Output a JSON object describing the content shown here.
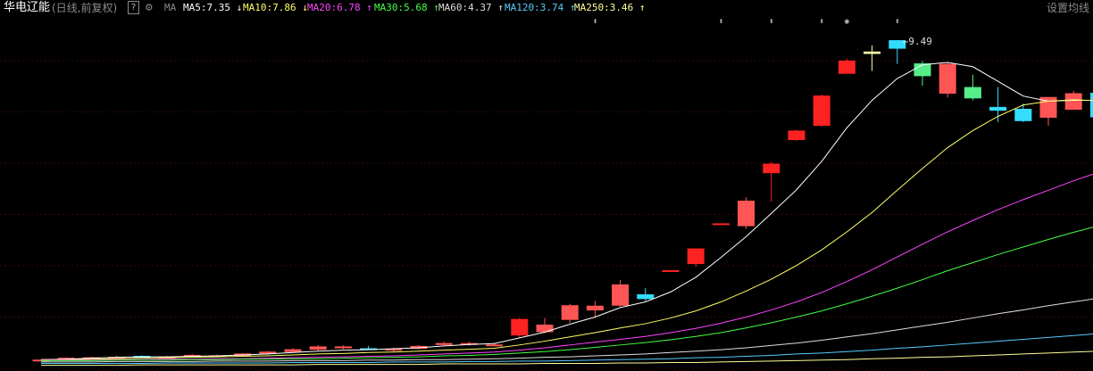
{
  "toolbar": {
    "stock_name": "华电辽能",
    "period": "(日线,前复权)",
    "help": "?",
    "indicator": "MA",
    "settings": "设置均线"
  },
  "ma_legend": [
    {
      "label": "MA5:7.35",
      "arrow": "↓",
      "color": "#ffffff"
    },
    {
      "label": "MA10:7.86",
      "arrow": "↓",
      "color": "#ffff66"
    },
    {
      "label": "MA20:6.78",
      "arrow": "↑",
      "color": "#ff44ff"
    },
    {
      "label": "MA30:5.68",
      "arrow": "↑",
      "color": "#44ff44"
    },
    {
      "label": "MA60:4.37",
      "arrow": "↑",
      "color": "#dddddd"
    },
    {
      "label": "MA120:3.74",
      "arrow": "↑",
      "color": "#55ccff"
    },
    {
      "label": "MA250:3.46",
      "arrow": "↑",
      "color": "#ffff99"
    }
  ],
  "colors": {
    "up_hollow": "#ff5555",
    "up_solid": "#ee0000",
    "down": "#33ddff",
    "limit_up": "#ff2222",
    "green_candle": "#55ee88",
    "doji": "#ffffaa",
    "grid": "#3a0a0a"
  },
  "high_marker": "←9.49",
  "markers": [
    "⬍",
    "⬍",
    "⬍",
    "⬍",
    "✱",
    "⬍"
  ],
  "chart_data": {
    "type": "candlestick",
    "y_range": [
      2.5,
      10.0
    ],
    "candles": [
      {
        "o": 2.73,
        "h": 2.75,
        "l": 2.71,
        "c": 2.74,
        "k": "up"
      },
      {
        "o": 2.74,
        "h": 2.79,
        "l": 2.73,
        "c": 2.78,
        "k": "up"
      },
      {
        "o": 2.78,
        "h": 2.8,
        "l": 2.76,
        "c": 2.79,
        "k": "up"
      },
      {
        "o": 2.79,
        "h": 2.82,
        "l": 2.77,
        "c": 2.8,
        "k": "up"
      },
      {
        "o": 2.8,
        "h": 2.83,
        "l": 2.79,
        "c": 2.82,
        "k": "dn"
      },
      {
        "o": 2.8,
        "h": 2.82,
        "l": 2.78,
        "c": 2.79,
        "k": "up"
      },
      {
        "o": 2.81,
        "h": 2.86,
        "l": 2.79,
        "c": 2.84,
        "k": "up"
      },
      {
        "o": 2.82,
        "h": 2.85,
        "l": 2.8,
        "c": 2.83,
        "k": "up"
      },
      {
        "o": 2.82,
        "h": 2.88,
        "l": 2.81,
        "c": 2.87,
        "k": "up"
      },
      {
        "o": 2.86,
        "h": 2.92,
        "l": 2.84,
        "c": 2.91,
        "k": "up"
      },
      {
        "o": 2.9,
        "h": 2.98,
        "l": 2.88,
        "c": 2.96,
        "k": "up"
      },
      {
        "o": 2.95,
        "h": 3.05,
        "l": 2.93,
        "c": 3.02,
        "k": "up"
      },
      {
        "o": 3.02,
        "h": 3.04,
        "l": 2.96,
        "c": 2.98,
        "k": "up"
      },
      {
        "o": 2.98,
        "h": 3.03,
        "l": 2.95,
        "c": 2.96,
        "k": "dn"
      },
      {
        "o": 2.93,
        "h": 2.99,
        "l": 2.91,
        "c": 2.97,
        "k": "up"
      },
      {
        "o": 2.97,
        "h": 3.05,
        "l": 2.95,
        "c": 3.03,
        "k": "up"
      },
      {
        "o": 3.05,
        "h": 3.12,
        "l": 3.02,
        "c": 3.09,
        "k": "up"
      },
      {
        "o": 3.09,
        "h": 3.12,
        "l": 3.03,
        "c": 3.06,
        "k": "up"
      },
      {
        "o": 3.06,
        "h": 3.1,
        "l": 3.03,
        "c": 3.05,
        "k": "up"
      },
      {
        "o": 3.25,
        "h": 3.62,
        "l": 3.2,
        "c": 3.6,
        "k": "lim"
      },
      {
        "o": 3.32,
        "h": 3.62,
        "l": 3.3,
        "c": 3.48,
        "k": "up"
      },
      {
        "o": 3.58,
        "h": 3.92,
        "l": 3.52,
        "c": 3.89,
        "k": "up"
      },
      {
        "o": 3.78,
        "h": 3.98,
        "l": 3.62,
        "c": 3.88,
        "k": "up"
      },
      {
        "o": 3.88,
        "h": 4.42,
        "l": 3.86,
        "c": 4.33,
        "k": "up"
      },
      {
        "o": 4.02,
        "h": 4.25,
        "l": 3.98,
        "c": 4.12,
        "k": "dn"
      },
      {
        "o": 4.62,
        "h": 4.62,
        "l": 4.62,
        "c": 4.63,
        "k": "flat"
      },
      {
        "o": 4.76,
        "h": 5.09,
        "l": 4.7,
        "c": 5.09,
        "k": "lim"
      },
      {
        "o": 5.62,
        "h": 5.62,
        "l": 5.6,
        "c": 5.6,
        "k": "flat"
      },
      {
        "o": 5.56,
        "h": 6.17,
        "l": 5.5,
        "c": 6.1,
        "k": "up"
      },
      {
        "o": 6.68,
        "h": 6.92,
        "l": 6.08,
        "c": 6.88,
        "k": "lim"
      },
      {
        "o": 7.38,
        "h": 7.6,
        "l": 7.36,
        "c": 7.58,
        "k": "lim"
      },
      {
        "o": 7.68,
        "h": 8.34,
        "l": 7.66,
        "c": 8.32,
        "k": "lim"
      },
      {
        "o": 8.78,
        "h": 9.1,
        "l": 8.78,
        "c": 9.06,
        "k": "lim"
      },
      {
        "o": 9.25,
        "h": 9.38,
        "l": 8.84,
        "c": 9.2,
        "k": "doji"
      },
      {
        "o": 9.49,
        "h": 9.49,
        "l": 8.99,
        "c": 9.31,
        "k": "dn"
      },
      {
        "o": 8.73,
        "h": 9.05,
        "l": 8.53,
        "c": 9.0,
        "k": "grn"
      },
      {
        "o": 8.36,
        "h": 9.01,
        "l": 8.28,
        "c": 8.99,
        "k": "up"
      },
      {
        "o": 8.26,
        "h": 8.76,
        "l": 8.22,
        "c": 8.5,
        "k": "grn"
      },
      {
        "o": 8.0,
        "h": 8.5,
        "l": 7.76,
        "c": 8.08,
        "k": "dn"
      },
      {
        "o": 7.78,
        "h": 8.15,
        "l": 7.76,
        "c": 8.04,
        "k": "dn"
      },
      {
        "o": 7.85,
        "h": 8.29,
        "l": 7.68,
        "c": 8.29,
        "k": "up"
      },
      {
        "o": 8.02,
        "h": 8.42,
        "l": 8.02,
        "c": 8.37,
        "k": "up"
      },
      {
        "o": 7.86,
        "h": 8.4,
        "l": 7.8,
        "c": 8.38,
        "k": "dn"
      }
    ],
    "ma_series": [
      {
        "name": "MA5",
        "color": "#ffffff",
        "values": [
          2.74,
          2.75,
          2.77,
          2.79,
          2.8,
          2.8,
          2.81,
          2.82,
          2.84,
          2.86,
          2.89,
          2.92,
          2.94,
          2.95,
          2.97,
          2.99,
          3.03,
          3.06,
          3.08,
          3.2,
          3.32,
          3.49,
          3.64,
          3.84,
          3.96,
          4.17,
          4.48,
          4.9,
          5.34,
          5.83,
          6.33,
          6.93,
          7.64,
          8.22,
          8.68,
          8.97,
          9.02,
          8.93,
          8.62,
          8.31,
          8.2,
          8.22,
          8.22
        ]
      },
      {
        "name": "MA10",
        "color": "#ffff66",
        "values": [
          2.74,
          2.74,
          2.75,
          2.76,
          2.77,
          2.78,
          2.79,
          2.8,
          2.81,
          2.82,
          2.84,
          2.86,
          2.87,
          2.89,
          2.9,
          2.92,
          2.94,
          2.96,
          2.98,
          3.05,
          3.13,
          3.22,
          3.31,
          3.41,
          3.5,
          3.62,
          3.77,
          3.96,
          4.19,
          4.44,
          4.73,
          5.06,
          5.44,
          5.85,
          6.32,
          6.78,
          7.22,
          7.58,
          7.88,
          8.12,
          8.2,
          8.23,
          8.21
        ]
      },
      {
        "name": "MA20",
        "color": "#ff44ff",
        "values": [
          2.73,
          2.73,
          2.73,
          2.74,
          2.74,
          2.75,
          2.75,
          2.76,
          2.76,
          2.77,
          2.78,
          2.79,
          2.8,
          2.81,
          2.82,
          2.84,
          2.86,
          2.88,
          2.9,
          2.94,
          2.99,
          3.05,
          3.11,
          3.17,
          3.23,
          3.31,
          3.4,
          3.51,
          3.64,
          3.79,
          3.96,
          4.16,
          4.39,
          4.64,
          4.91,
          5.18,
          5.44,
          5.68,
          5.91,
          6.12,
          6.32,
          6.52,
          6.7
        ]
      },
      {
        "name": "MA30",
        "color": "#44ff44",
        "values": [
          2.72,
          2.72,
          2.72,
          2.73,
          2.73,
          2.73,
          2.74,
          2.74,
          2.75,
          2.75,
          2.76,
          2.76,
          2.77,
          2.78,
          2.79,
          2.8,
          2.82,
          2.83,
          2.85,
          2.88,
          2.91,
          2.95,
          3.0,
          3.05,
          3.1,
          3.16,
          3.23,
          3.31,
          3.41,
          3.52,
          3.64,
          3.77,
          3.92,
          4.08,
          4.25,
          4.43,
          4.62,
          4.79,
          4.96,
          5.12,
          5.28,
          5.43,
          5.57
        ]
      },
      {
        "name": "MA60",
        "color": "#dddddd",
        "values": [
          2.69,
          2.69,
          2.69,
          2.7,
          2.7,
          2.7,
          2.7,
          2.71,
          2.71,
          2.71,
          2.72,
          2.72,
          2.72,
          2.73,
          2.73,
          2.74,
          2.74,
          2.75,
          2.76,
          2.77,
          2.79,
          2.8,
          2.82,
          2.84,
          2.86,
          2.89,
          2.92,
          2.95,
          2.99,
          3.04,
          3.09,
          3.15,
          3.22,
          3.29,
          3.37,
          3.45,
          3.53,
          3.62,
          3.71,
          3.79,
          3.88,
          3.96,
          4.04
        ]
      },
      {
        "name": "MA120",
        "color": "#55ccff",
        "values": [
          2.66,
          2.66,
          2.66,
          2.66,
          2.66,
          2.67,
          2.67,
          2.67,
          2.67,
          2.67,
          2.68,
          2.68,
          2.68,
          2.68,
          2.69,
          2.69,
          2.69,
          2.7,
          2.7,
          2.71,
          2.71,
          2.72,
          2.73,
          2.74,
          2.75,
          2.76,
          2.78,
          2.79,
          2.81,
          2.83,
          2.86,
          2.88,
          2.91,
          2.94,
          2.98,
          3.01,
          3.05,
          3.09,
          3.13,
          3.17,
          3.21,
          3.25,
          3.29
        ]
      },
      {
        "name": "MA250",
        "color": "#ffff99",
        "values": [
          2.62,
          2.62,
          2.62,
          2.62,
          2.63,
          2.63,
          2.63,
          2.63,
          2.63,
          2.63,
          2.63,
          2.64,
          2.64,
          2.64,
          2.64,
          2.64,
          2.65,
          2.65,
          2.65,
          2.65,
          2.66,
          2.66,
          2.66,
          2.67,
          2.67,
          2.68,
          2.68,
          2.69,
          2.7,
          2.71,
          2.72,
          2.73,
          2.74,
          2.76,
          2.77,
          2.79,
          2.8,
          2.82,
          2.84,
          2.86,
          2.88,
          2.9,
          2.92
        ]
      }
    ]
  }
}
